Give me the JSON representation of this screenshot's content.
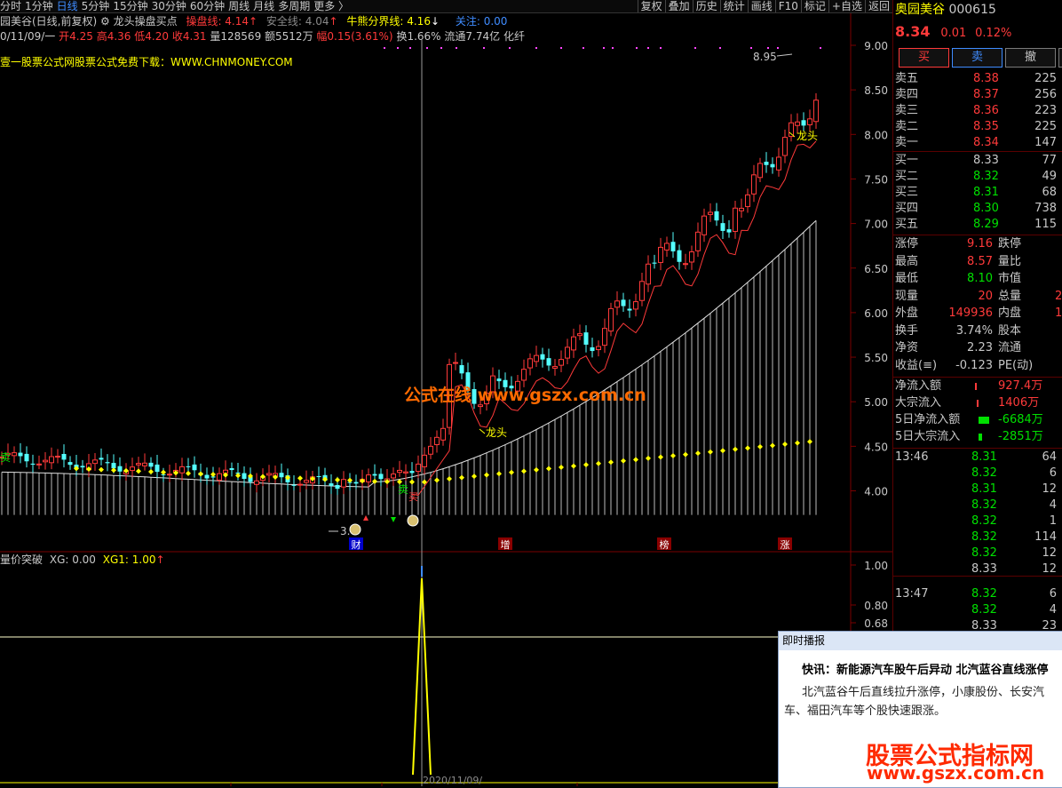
{
  "toolbar": {
    "periods": [
      "分时",
      "1分钟",
      "日线",
      "5分钟",
      "15分钟",
      "30分钟",
      "60分钟",
      "周线",
      "月线",
      "多周期",
      "更多 〉"
    ],
    "active_period": "日线",
    "right_buttons": [
      "复权",
      "叠加",
      "历史",
      "统计",
      "画线",
      "F10",
      "标记",
      "+自选",
      "返回"
    ]
  },
  "chart_header": {
    "name_part": "园美谷(日线,前复权)",
    "indicator_name": "龙头操盘买点",
    "cao_pan_label": "操盘线: 4.14",
    "safe_label": "安全线: 4.04",
    "bull_label": "牛熊分界线: 4.16",
    "focus_label": "关注: 0.00",
    "info_date": "0/11/09/一",
    "info_open": "开4.25",
    "info_high": "高4.36",
    "info_low": "低4.20",
    "info_close": "收4.31",
    "info_vol": "量128569",
    "info_amount": "额5512万",
    "info_amp": "幅0.15(3.61%)",
    "info_turn": "换1.66%",
    "info_float": "流通7.74亿 化纤",
    "ad_line": "壹一股票公式网股票公式免费下载：WWW.CHNMONEY.COM"
  },
  "watermarks": {
    "center": "公式在线 www.gszx.com.cn",
    "corner_title": "股票公式指标网",
    "corner_url": "www.gszx.com.cn"
  },
  "markers": {
    "long_head_1": "龙头",
    "long_head_2": "龙头",
    "sell_1": "卖",
    "sell_2": "卖",
    "buy_1": "买",
    "low_label": "3.",
    "peak_label": "8.95",
    "tags": [
      "财",
      "增",
      "榜",
      "涨"
    ]
  },
  "price_axis": [
    "9.00",
    "8.50",
    "8.00",
    "7.50",
    "7.00",
    "6.50",
    "6.00",
    "5.50",
    "5.00",
    "4.50",
    "4.00"
  ],
  "lower_panel": {
    "title": "量价突破",
    "xg": "XG: 0.00",
    "xg1": "XG1: 1.00",
    "axis": [
      "1.00",
      "0.80",
      "0.68"
    ],
    "date_hint": "2020/11/09/"
  },
  "colors": {
    "up": "#ff3a3a",
    "down": "#54ffff",
    "yellow": "#ffff00",
    "blue": "#3f8cff",
    "green": "#00e000"
  },
  "quote": {
    "name": "奥园美谷",
    "code": "000615",
    "price": "8.34",
    "change": "0.01",
    "change_pct": "0.12%",
    "buttons": [
      "买",
      "卖",
      "撤"
    ],
    "asks": [
      {
        "label": "卖五",
        "price": "8.38",
        "vol": "225"
      },
      {
        "label": "卖四",
        "price": "8.37",
        "vol": "256"
      },
      {
        "label": "卖三",
        "price": "8.36",
        "vol": "223"
      },
      {
        "label": "卖二",
        "price": "8.35",
        "vol": "225"
      },
      {
        "label": "卖一",
        "price": "8.34",
        "vol": "147"
      }
    ],
    "bids": [
      {
        "label": "买一",
        "price": "8.33",
        "vol": "77"
      },
      {
        "label": "买二",
        "price": "8.32",
        "vol": "49"
      },
      {
        "label": "买三",
        "price": "8.31",
        "vol": "68"
      },
      {
        "label": "买四",
        "price": "8.30",
        "vol": "738"
      },
      {
        "label": "买五",
        "price": "8.29",
        "vol": "115"
      }
    ],
    "stats": [
      {
        "l1": "涨停",
        "v1": "9.16",
        "l2": "跌停"
      },
      {
        "l1": "最高",
        "v1": "8.57",
        "l2": "量比"
      },
      {
        "l1": "最低",
        "v1": "8.10",
        "l2": "市值"
      },
      {
        "l1": "现量",
        "v1": "20",
        "l2": "总量",
        "v2": "2"
      },
      {
        "l1": "外盘",
        "v1": "149936",
        "l2": "内盘",
        "v2": "1"
      },
      {
        "l1": "换手",
        "v1": "3.74%",
        "l2": "股本"
      },
      {
        "l1": "净资",
        "v1": "2.23",
        "l2": "流通"
      },
      {
        "l1": "收益(≡)",
        "v1": "-0.123",
        "l2": "PE(动)"
      }
    ],
    "flows": [
      {
        "label": "净流入额",
        "value": "927.4万"
      },
      {
        "label": "大宗流入",
        "value": "1406万"
      },
      {
        "label": "5日净流入额",
        "value": "-6684万"
      },
      {
        "label": "5日大宗流入",
        "value": "-2851万"
      }
    ],
    "ticks": [
      {
        "time": "13:46",
        "price": "8.31",
        "vol": "64"
      },
      {
        "time": "",
        "price": "8.32",
        "vol": "6"
      },
      {
        "time": "",
        "price": "8.31",
        "vol": "12"
      },
      {
        "time": "",
        "price": "8.32",
        "vol": "4"
      },
      {
        "time": "",
        "price": "8.32",
        "vol": "1"
      },
      {
        "time": "",
        "price": "8.32",
        "vol": "114"
      },
      {
        "time": "",
        "price": "8.32",
        "vol": "12"
      },
      {
        "time": "",
        "price": "8.33",
        "vol": "12"
      },
      {
        "time": "13:47",
        "price": "8.32",
        "vol": "6"
      },
      {
        "time": "",
        "price": "8.32",
        "vol": "4"
      },
      {
        "time": "",
        "price": "8.33",
        "vol": "23"
      }
    ]
  },
  "popup": {
    "header": "即时播报",
    "headline": "快讯：新能源汽车股午后异动 北汽蓝谷直线涨停",
    "body": "北汽蓝谷午后直线拉升涨停，小康股份、长安汽车、福田汽车等个股快速跟涨。"
  }
}
